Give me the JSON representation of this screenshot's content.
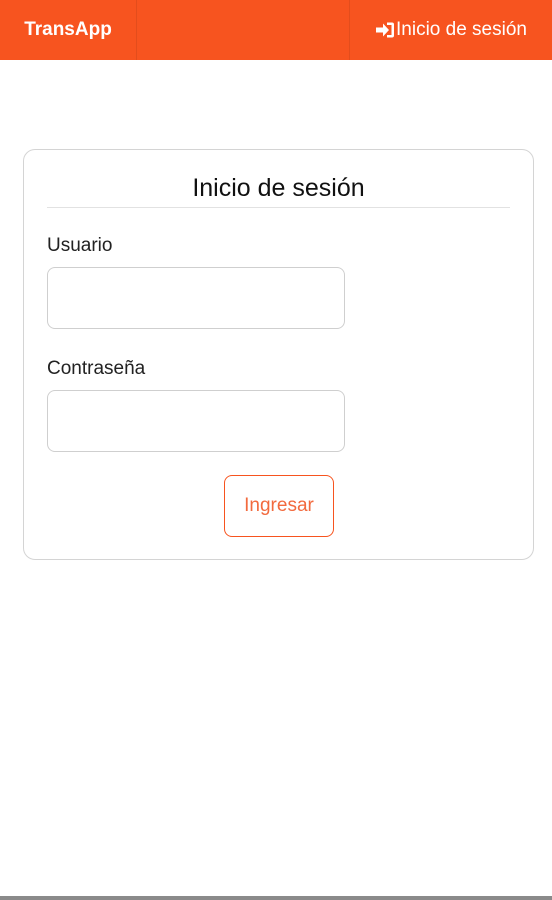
{
  "navbar": {
    "brand": "TransApp",
    "login_link": "Inicio de sesión",
    "login_icon": "sign-in-icon",
    "color": "#f7541f"
  },
  "login_card": {
    "title": "Inicio de sesión",
    "username_label": "Usuario",
    "username_value": "",
    "password_label": "Contraseña",
    "password_value": "",
    "submit_label": "Ingresar"
  }
}
